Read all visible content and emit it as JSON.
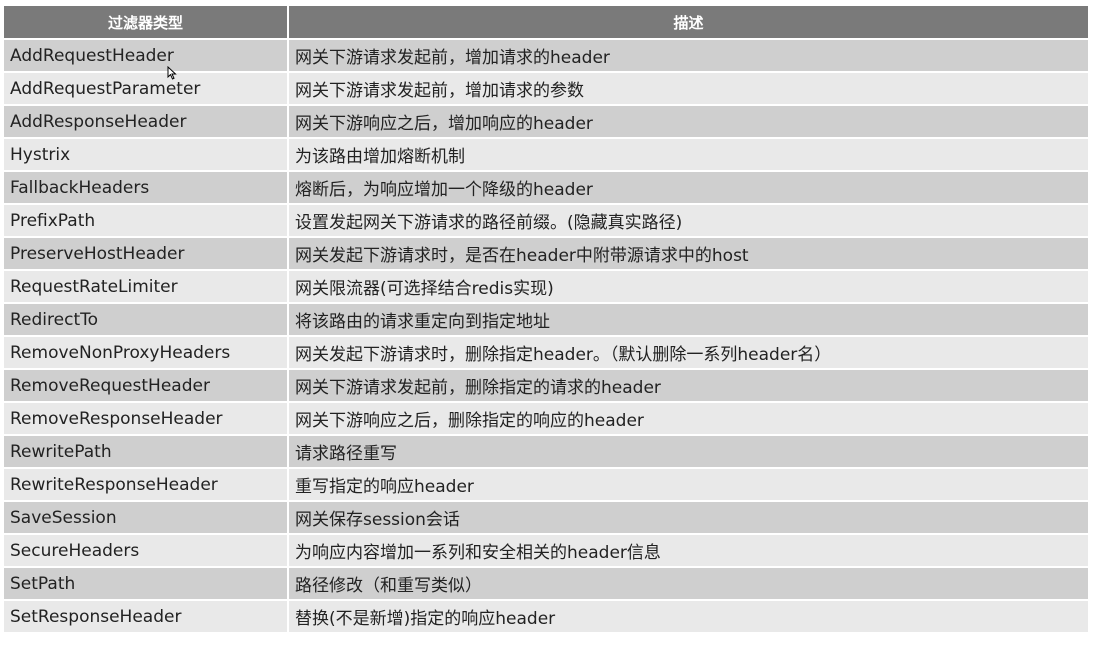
{
  "table": {
    "headers": [
      "过滤器类型",
      "描述"
    ],
    "rows": [
      {
        "type": "AddRequestHeader",
        "desc": "网关下游请求发起前，增加请求的header"
      },
      {
        "type": "AddRequestParameter",
        "desc": "网关下游请求发起前，增加请求的参数"
      },
      {
        "type": "AddResponseHeader",
        "desc": "网关下游响应之后，增加响应的header"
      },
      {
        "type": "Hystrix",
        "desc": "为该路由增加熔断机制"
      },
      {
        "type": "FallbackHeaders",
        "desc": "熔断后，为响应增加一个降级的header"
      },
      {
        "type": "PrefixPath",
        "desc": "设置发起网关下游请求的路径前缀。(隐藏真实路径)"
      },
      {
        "type": "PreserveHostHeader",
        "desc": "网关发起下游请求时，是否在header中附带源请求中的host"
      },
      {
        "type": "RequestRateLimiter",
        "desc": "网关限流器(可选择结合redis实现)"
      },
      {
        "type": "RedirectTo",
        "desc": "将该路由的请求重定向到指定地址"
      },
      {
        "type": "RemoveNonProxyHeaders",
        "desc": "网关发起下游请求时，删除指定header。（默认删除一系列header名）"
      },
      {
        "type": "RemoveRequestHeader",
        "desc": "网关下游请求发起前，删除指定的请求的header"
      },
      {
        "type": "RemoveResponseHeader",
        "desc": "网关下游响应之后，删除指定的响应的header"
      },
      {
        "type": "RewritePath",
        "desc": "请求路径重写"
      },
      {
        "type": "RewriteResponseHeader",
        "desc": "重写指定的响应header"
      },
      {
        "type": "SaveSession",
        "desc": "网关保存session会话"
      },
      {
        "type": "SecureHeaders",
        "desc": "为响应内容增加一系列和安全相关的header信息"
      },
      {
        "type": "SetPath",
        "desc": "路径修改（和重写类似）"
      },
      {
        "type": "SetResponseHeader",
        "desc": "替换(不是新增)指定的响应header"
      }
    ]
  },
  "cursor": {
    "icon": "mouse-pointer-icon"
  }
}
